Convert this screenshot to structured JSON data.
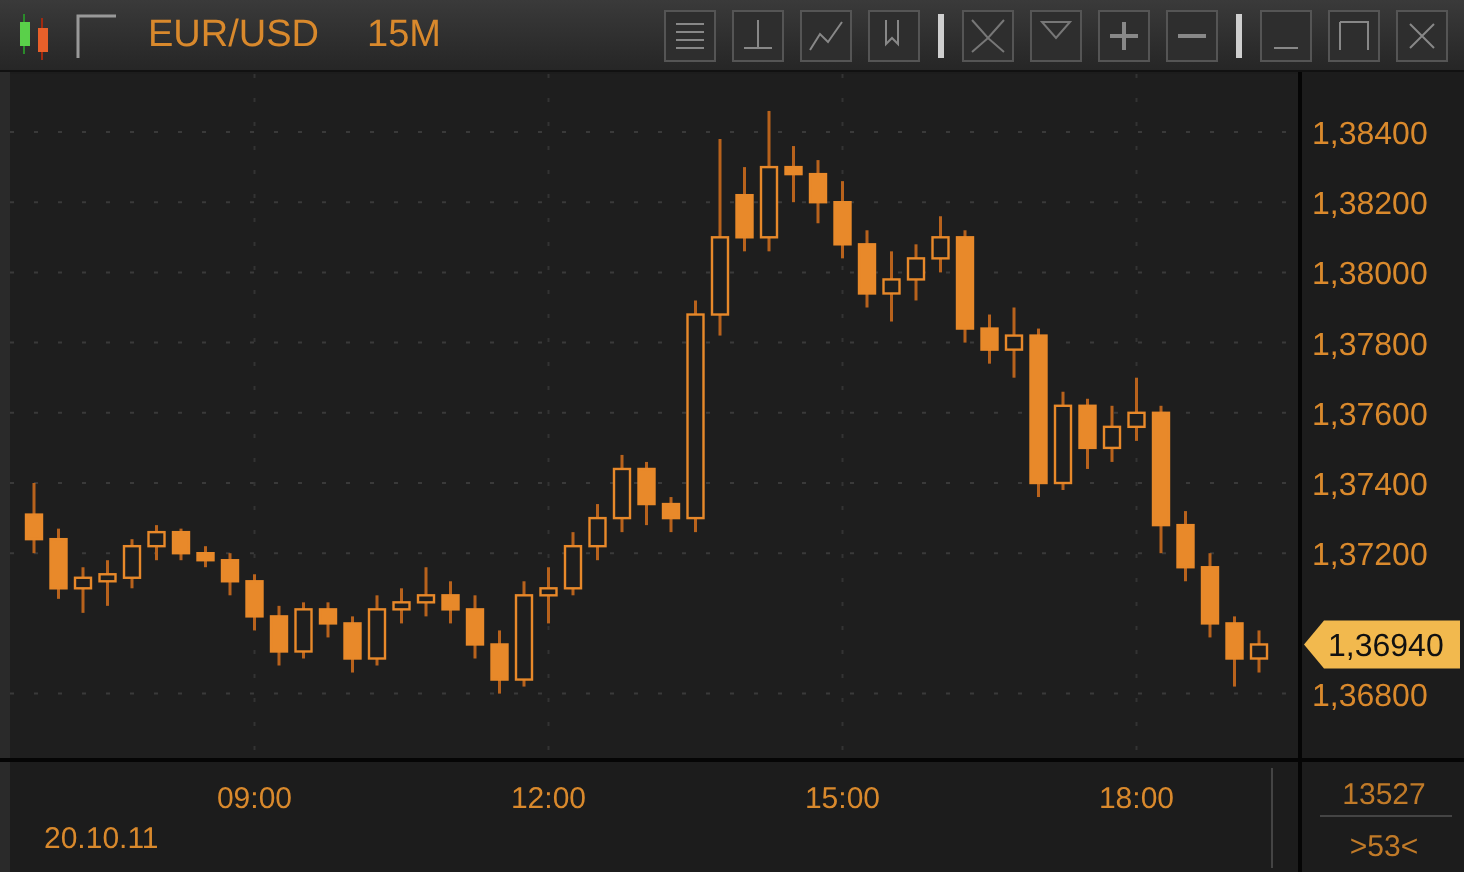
{
  "toolbar": {
    "symbol": "EUR/USD",
    "timeframe": "15M"
  },
  "chart": {
    "price_labels": [
      "1,38400",
      "1,38200",
      "1,38000",
      "1,37800",
      "1,37600",
      "1,37400",
      "1,37200",
      "1,36800"
    ],
    "last_price": "1,36940",
    "time_labels": [
      "09:00",
      "12:00",
      "15:00",
      "18:00"
    ],
    "date_label": "20.10.11",
    "footer_values": [
      "13527",
      ">53<"
    ]
  }
}
